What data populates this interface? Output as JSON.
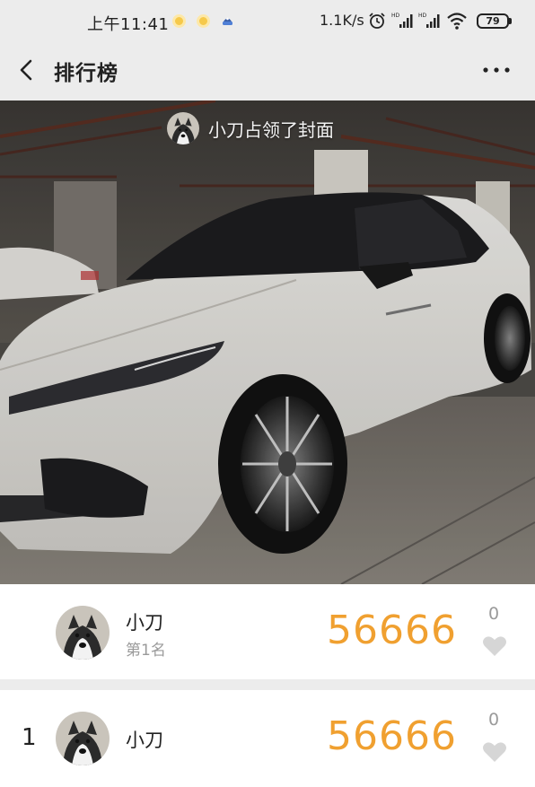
{
  "status_bar": {
    "time": "上午11:41",
    "speed": "1.1K/s",
    "battery": "79"
  },
  "nav": {
    "title": "排行榜"
  },
  "cover": {
    "caption": "小刀占领了封面"
  },
  "top_entry": {
    "name": "小刀",
    "rank_label": "第1名",
    "score": "56666",
    "likes": "0"
  },
  "ranking": [
    {
      "rank": "1",
      "name": "小刀",
      "score": "56666",
      "likes": "0"
    }
  ],
  "colors": {
    "score": "#f0a030",
    "muted": "#9a9a9a",
    "background": "#ececec"
  }
}
